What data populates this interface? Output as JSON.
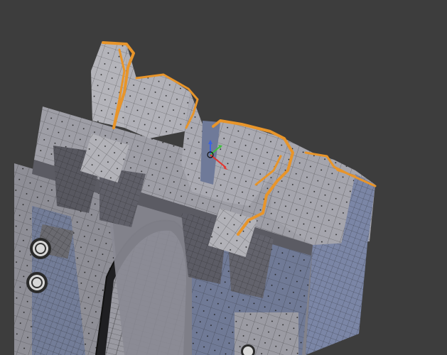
{
  "viewport": {
    "background_color": "#3d3d3d",
    "selection_color": "#e8952a",
    "mesh_face_color": "#a9a9ad",
    "mesh_shadow_color": "#6f7a99",
    "wire_color": "#1a1a1a"
  },
  "gizmo": {
    "icons": [
      "axis-x-red-arrow",
      "axis-y-green-arrow",
      "axis-z-blue-arrow",
      "origin-circle"
    ],
    "x_color": "#e5342e",
    "y_color": "#3fbf3f",
    "z_color": "#3a63e0"
  },
  "object": {
    "name_icon": "castle-gate-mesh",
    "selected_edges": "top-broken-edges"
  }
}
